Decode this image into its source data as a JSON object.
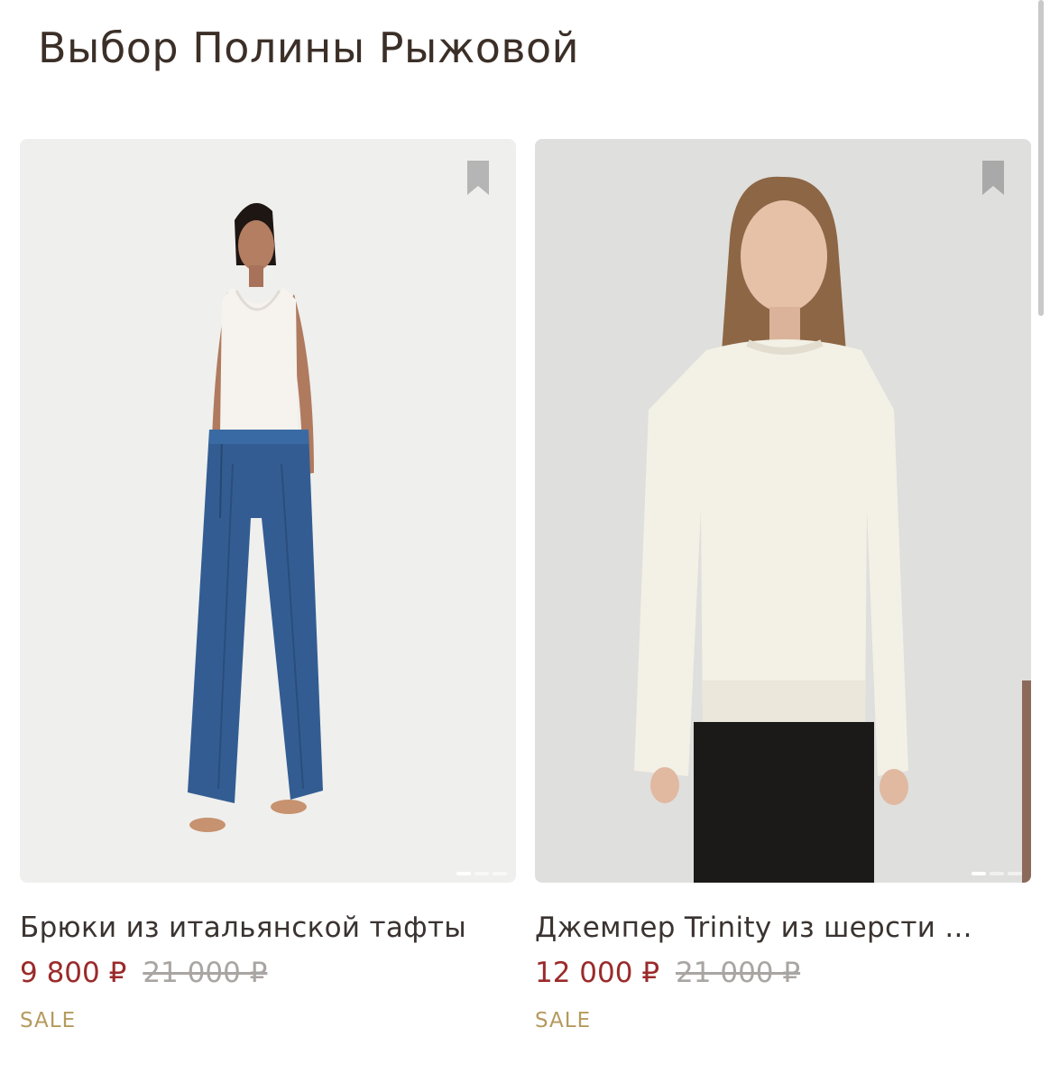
{
  "header": {
    "title": "Выбор Полины Рыжовой"
  },
  "products": [
    {
      "name": "Брюки из итальянской тафты",
      "price": "9 800 ₽",
      "old_price": "21 000 ₽",
      "badge": "SALE",
      "image_icon": "model-in-blue-trousers-photo",
      "gallery_count": 3,
      "gallery_active": 1
    },
    {
      "name": "Джемпер Trinity из шерсти ...",
      "price": "12 000 ₽",
      "old_price": "21 000 ₽",
      "badge": "SALE",
      "image_icon": "model-in-white-jumper-photo",
      "gallery_count": 3,
      "gallery_active": 1
    }
  ],
  "colors": {
    "title": "#3b2f27",
    "price_sale": "#9b2a2a",
    "price_old": "#a9a5a2",
    "badge": "#b59a5e"
  }
}
